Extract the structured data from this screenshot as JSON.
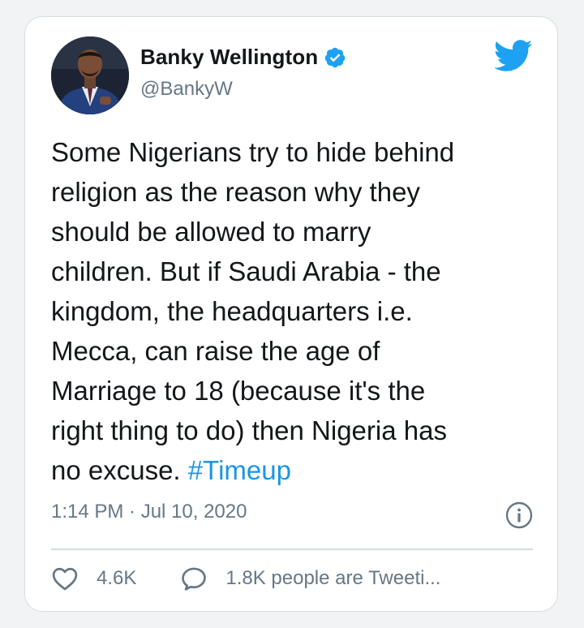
{
  "author": {
    "name": "Banky Wellington",
    "handle": "@BankyW",
    "verified": true
  },
  "tweet": {
    "text": "Some Nigerians try to hide behind\nreligion as the reason why they\nshould be allowed to marry\nchildren. But if Saudi Arabia - the\nkingdom, the headquarters i.e.\nMecca, can raise the age of\nMarriage to 18 (because it's the\nright thing to do) then Nigeria has\nno excuse. ",
    "hashtag": "#Timeup"
  },
  "meta": {
    "timestamp": "1:14 PM · Jul 10, 2020"
  },
  "engagement": {
    "likes": "4.6K",
    "conversation": "1.8K people are Tweeti..."
  },
  "icons": {
    "logo": "twitter-bird-icon",
    "verified": "verified-badge-icon",
    "info": "info-icon",
    "like": "heart-icon",
    "reply": "speech-bubble-icon"
  },
  "colors": {
    "brand": "#1da1f2",
    "hashtag": "#1b95e0",
    "secondary_text": "#657786",
    "border": "#d5dce1"
  }
}
